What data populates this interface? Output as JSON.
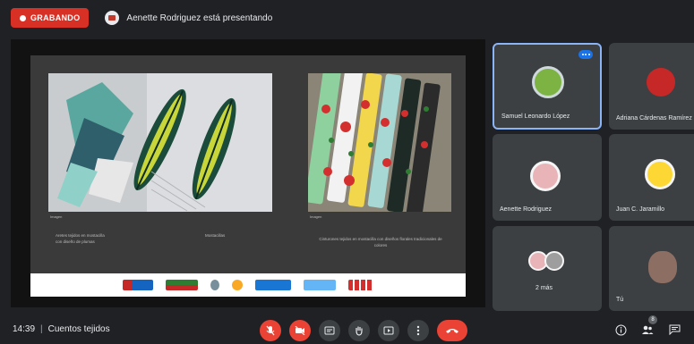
{
  "header": {
    "recording_label": "GRABANDO",
    "presenter_text": "Aenette Rodriguez está presentando"
  },
  "slide": {
    "caption_left": "Imagen",
    "caption_right": "Imagen",
    "text_left": "Aretes tejidos en mostacilla con diseño de plumas",
    "text_middle": "Mostacillas",
    "text_right": "Cinturones tejidos en mostacilla con diseños florales tradicionales de colores"
  },
  "participants": [
    {
      "name": "Samuel Leonardo López",
      "avatar_color": "#7cb342",
      "active": true
    },
    {
      "name": "Adriana Cárdenas Ramírez",
      "avatar_color": "#c62828",
      "active": false
    },
    {
      "name": "Aenette Rodriguez",
      "avatar_color": "#e8b4b8",
      "active": false
    },
    {
      "name": "Juan C. Jaramillo",
      "avatar_color": "#fdd835",
      "active": false
    },
    {
      "name": "2 más",
      "avatar_color": "#bdbdbd",
      "active": false
    },
    {
      "name": "Tú",
      "avatar_color": "#8d6e63",
      "active": false
    }
  ],
  "footer": {
    "time": "14:39",
    "meeting_name": "Cuentos tejidos",
    "participant_count": "8"
  },
  "colors": {
    "background": "#202124",
    "tile": "#3c4043",
    "accent": "#8ab4f8",
    "danger": "#ea4335"
  }
}
